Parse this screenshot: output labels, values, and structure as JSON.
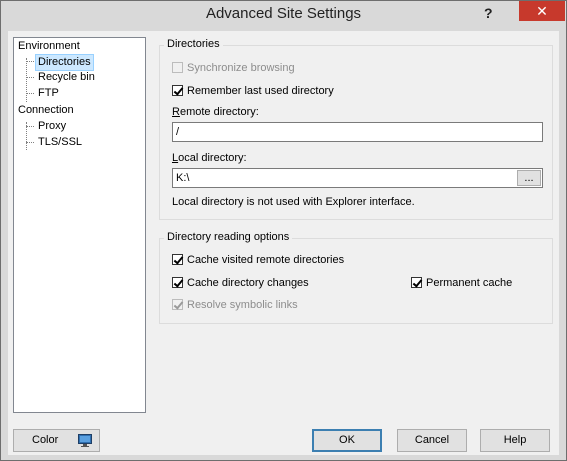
{
  "window": {
    "title": "Advanced Site Settings",
    "help_glyph": "?",
    "close_glyph": "✕"
  },
  "tree": {
    "items": [
      {
        "label": "Environment",
        "level": 0
      },
      {
        "label": "Directories",
        "level": 1,
        "selected": true
      },
      {
        "label": "Recycle bin",
        "level": 1
      },
      {
        "label": "FTP",
        "level": 1
      },
      {
        "label": "Connection",
        "level": 0
      },
      {
        "label": "Proxy",
        "level": 1
      },
      {
        "label": "TLS/SSL",
        "level": 1
      }
    ]
  },
  "directories": {
    "group_title": "Directories",
    "sync_browsing": {
      "label": "Synchronize browsing",
      "checked": false,
      "enabled": false
    },
    "remember_last": {
      "label": "Remember last used directory",
      "checked": true,
      "enabled": true
    },
    "remote_label_u": "R",
    "remote_label_rest": "emote directory:",
    "remote_value": "/",
    "local_label_u": "L",
    "local_label_rest": "ocal directory:",
    "local_value": "K:\\",
    "browse_label": "...",
    "note": "Local directory is not used with Explorer interface."
  },
  "reading": {
    "group_title": "Directory reading options",
    "cache_visited": {
      "label": "Cache visited remote directories",
      "checked": true,
      "enabled": true
    },
    "cache_changes": {
      "label": "Cache directory changes",
      "checked": true,
      "enabled": true
    },
    "permanent_cache": {
      "label": "Permanent cache",
      "checked": true,
      "enabled": true
    },
    "resolve_links": {
      "label": "Resolve symbolic links",
      "checked": true,
      "enabled": false
    }
  },
  "buttons": {
    "color": "Color",
    "ok": "OK",
    "cancel": "Cancel",
    "help": "Help"
  },
  "colors": {
    "close_button": "#c7392c",
    "selection": "#cce8ff",
    "default_button_border": "#3c7fb1"
  }
}
